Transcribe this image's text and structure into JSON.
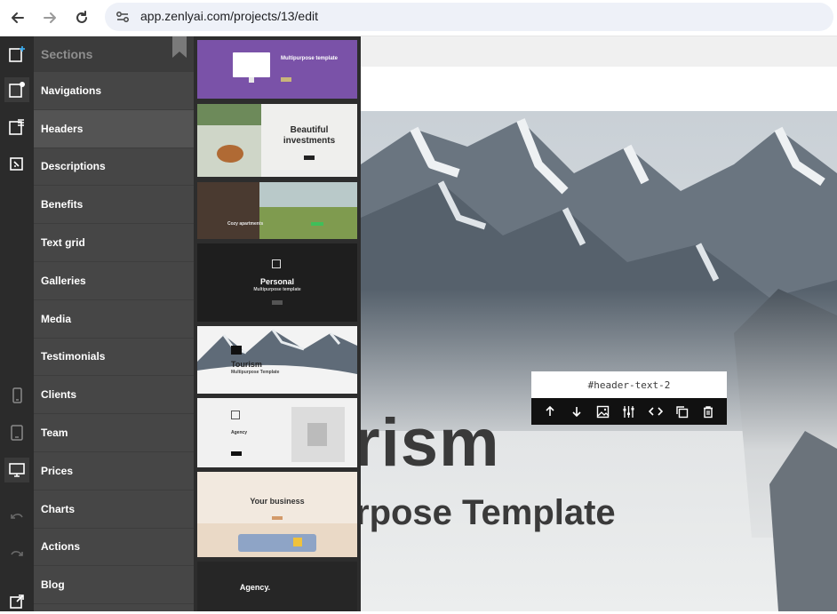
{
  "browser": {
    "url": "app.zenlyai.com/projects/13/edit"
  },
  "sidebar": {
    "header": "Sections",
    "items": [
      {
        "label": "Navigations"
      },
      {
        "label": "Headers"
      },
      {
        "label": "Descriptions"
      },
      {
        "label": "Benefits"
      },
      {
        "label": "Text grid"
      },
      {
        "label": "Galleries"
      },
      {
        "label": "Media"
      },
      {
        "label": "Testimonials"
      },
      {
        "label": "Clients"
      },
      {
        "label": "Team"
      },
      {
        "label": "Prices"
      },
      {
        "label": "Charts"
      },
      {
        "label": "Actions"
      },
      {
        "label": "Blog"
      }
    ],
    "active_item": "Headers"
  },
  "thumbnails": {
    "t1_title": "Multipurpose template",
    "t2_title": "Beautiful investments",
    "t3_title": "Cozy apartments",
    "t4_title": "Personal",
    "t4_sub": "Multipurpose template",
    "t5_title": "Tourism",
    "t5_sub": "Multipurpose Template",
    "t6_title": "Agency",
    "t7_title": "Your business",
    "t8_title": "Agency."
  },
  "preview": {
    "hero_title": "rism",
    "hero_subtitle": "rpose Template",
    "selected_element_id": "#header-text-2"
  },
  "toolbar_icons": [
    "arrow-up-icon",
    "arrow-down-icon",
    "image-icon",
    "settings-sliders-icon",
    "code-icon",
    "duplicate-icon",
    "trash-icon"
  ],
  "colors": {
    "rail": "#2b2b2b",
    "sections_bg": "#464646",
    "active_item_bg": "#545454",
    "accent_purple": "#7a52a8",
    "toolbar_bg": "#111111"
  }
}
